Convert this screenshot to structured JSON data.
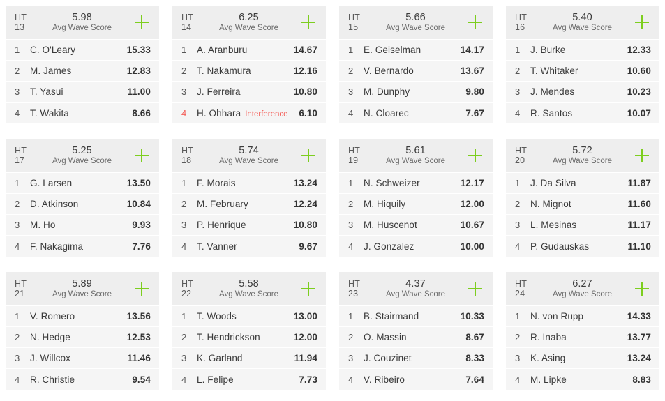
{
  "labels": {
    "heat_prefix": "HT",
    "avg_caption": "Avg Wave Score",
    "add_icon": "plus-icon"
  },
  "colors": {
    "accent_green": "#7dce1f",
    "interference_red": "#f4605a",
    "card_bg": "#f5f5f5",
    "header_bg": "#eeeeee",
    "page_bg": "#ffffff"
  },
  "heats": [
    {
      "heat_number": "13",
      "avg_wave_score": "5.98",
      "athletes": [
        {
          "rank": "1",
          "name": "C. O'Leary",
          "score": "15.33",
          "note": ""
        },
        {
          "rank": "2",
          "name": "M. James",
          "score": "12.83",
          "note": ""
        },
        {
          "rank": "3",
          "name": "T. Yasui",
          "score": "11.00",
          "note": ""
        },
        {
          "rank": "4",
          "name": "T. Wakita",
          "score": "8.66",
          "note": ""
        }
      ]
    },
    {
      "heat_number": "14",
      "avg_wave_score": "6.25",
      "athletes": [
        {
          "rank": "1",
          "name": "A. Aranburu",
          "score": "14.67",
          "note": ""
        },
        {
          "rank": "2",
          "name": "T. Nakamura",
          "score": "12.16",
          "note": ""
        },
        {
          "rank": "3",
          "name": "J. Ferreira",
          "score": "10.80",
          "note": ""
        },
        {
          "rank": "4",
          "name": "H. Ohhara",
          "score": "6.10",
          "note": "Interference"
        }
      ]
    },
    {
      "heat_number": "15",
      "avg_wave_score": "5.66",
      "athletes": [
        {
          "rank": "1",
          "name": "E. Geiselman",
          "score": "14.17",
          "note": ""
        },
        {
          "rank": "2",
          "name": "V. Bernardo",
          "score": "13.67",
          "note": ""
        },
        {
          "rank": "3",
          "name": "M. Dunphy",
          "score": "9.80",
          "note": ""
        },
        {
          "rank": "4",
          "name": "N. Cloarec",
          "score": "7.67",
          "note": ""
        }
      ]
    },
    {
      "heat_number": "16",
      "avg_wave_score": "5.40",
      "athletes": [
        {
          "rank": "1",
          "name": "J. Burke",
          "score": "12.33",
          "note": ""
        },
        {
          "rank": "2",
          "name": "T. Whitaker",
          "score": "10.60",
          "note": ""
        },
        {
          "rank": "3",
          "name": "J. Mendes",
          "score": "10.23",
          "note": ""
        },
        {
          "rank": "4",
          "name": "R. Santos",
          "score": "10.07",
          "note": ""
        }
      ]
    },
    {
      "heat_number": "17",
      "avg_wave_score": "5.25",
      "athletes": [
        {
          "rank": "1",
          "name": "G. Larsen",
          "score": "13.50",
          "note": ""
        },
        {
          "rank": "2",
          "name": "D. Atkinson",
          "score": "10.84",
          "note": ""
        },
        {
          "rank": "3",
          "name": "M. Ho",
          "score": "9.93",
          "note": ""
        },
        {
          "rank": "4",
          "name": "F. Nakagima",
          "score": "7.76",
          "note": ""
        }
      ]
    },
    {
      "heat_number": "18",
      "avg_wave_score": "5.74",
      "athletes": [
        {
          "rank": "1",
          "name": "F. Morais",
          "score": "13.24",
          "note": ""
        },
        {
          "rank": "2",
          "name": "M. February",
          "score": "12.24",
          "note": ""
        },
        {
          "rank": "3",
          "name": "P. Henrique",
          "score": "10.80",
          "note": ""
        },
        {
          "rank": "4",
          "name": "T. Vanner",
          "score": "9.67",
          "note": ""
        }
      ]
    },
    {
      "heat_number": "19",
      "avg_wave_score": "5.61",
      "athletes": [
        {
          "rank": "1",
          "name": "N. Schweizer",
          "score": "12.17",
          "note": ""
        },
        {
          "rank": "2",
          "name": "M. Hiquily",
          "score": "12.00",
          "note": ""
        },
        {
          "rank": "3",
          "name": "M. Huscenot",
          "score": "10.67",
          "note": ""
        },
        {
          "rank": "4",
          "name": "J. Gonzalez",
          "score": "10.00",
          "note": ""
        }
      ]
    },
    {
      "heat_number": "20",
      "avg_wave_score": "5.72",
      "athletes": [
        {
          "rank": "1",
          "name": "J. Da Silva",
          "score": "11.87",
          "note": ""
        },
        {
          "rank": "2",
          "name": "N. Mignot",
          "score": "11.60",
          "note": ""
        },
        {
          "rank": "3",
          "name": "L. Mesinas",
          "score": "11.17",
          "note": ""
        },
        {
          "rank": "4",
          "name": "P. Gudauskas",
          "score": "11.10",
          "note": ""
        }
      ]
    },
    {
      "heat_number": "21",
      "avg_wave_score": "5.89",
      "athletes": [
        {
          "rank": "1",
          "name": "V. Romero",
          "score": "13.56",
          "note": ""
        },
        {
          "rank": "2",
          "name": "N. Hedge",
          "score": "12.53",
          "note": ""
        },
        {
          "rank": "3",
          "name": "J. Willcox",
          "score": "11.46",
          "note": ""
        },
        {
          "rank": "4",
          "name": "R. Christie",
          "score": "9.54",
          "note": ""
        }
      ]
    },
    {
      "heat_number": "22",
      "avg_wave_score": "5.58",
      "athletes": [
        {
          "rank": "1",
          "name": "T. Woods",
          "score": "13.00",
          "note": ""
        },
        {
          "rank": "2",
          "name": "T. Hendrickson",
          "score": "12.00",
          "note": ""
        },
        {
          "rank": "3",
          "name": "K. Garland",
          "score": "11.94",
          "note": ""
        },
        {
          "rank": "4",
          "name": "L. Felipe",
          "score": "7.73",
          "note": ""
        }
      ]
    },
    {
      "heat_number": "23",
      "avg_wave_score": "4.37",
      "athletes": [
        {
          "rank": "1",
          "name": "B. Stairmand",
          "score": "10.33",
          "note": ""
        },
        {
          "rank": "2",
          "name": "O. Massin",
          "score": "8.67",
          "note": ""
        },
        {
          "rank": "3",
          "name": "J. Couzinet",
          "score": "8.33",
          "note": ""
        },
        {
          "rank": "4",
          "name": "V. Ribeiro",
          "score": "7.64",
          "note": ""
        }
      ]
    },
    {
      "heat_number": "24",
      "avg_wave_score": "6.27",
      "athletes": [
        {
          "rank": "1",
          "name": "N. von Rupp",
          "score": "14.33",
          "note": ""
        },
        {
          "rank": "2",
          "name": "R. Inaba",
          "score": "13.77",
          "note": ""
        },
        {
          "rank": "3",
          "name": "K. Asing",
          "score": "13.24",
          "note": ""
        },
        {
          "rank": "4",
          "name": "M. Lipke",
          "score": "8.83",
          "note": ""
        }
      ]
    }
  ]
}
